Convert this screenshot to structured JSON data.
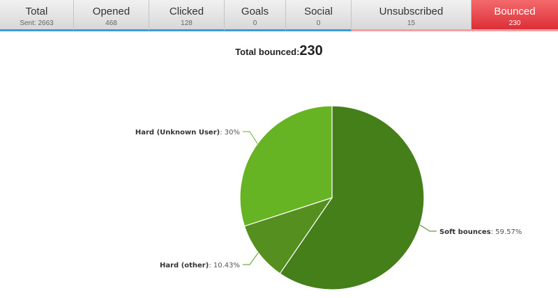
{
  "tabs": [
    {
      "label": "Total",
      "count": "Sent: 2663"
    },
    {
      "label": "Opened",
      "count": "468"
    },
    {
      "label": "Clicked",
      "count": "128"
    },
    {
      "label": "Goals",
      "count": "0"
    },
    {
      "label": "Social",
      "count": "0"
    },
    {
      "label": "Unsubscribed",
      "count": "15"
    },
    {
      "label": "Bounced",
      "count": "230"
    }
  ],
  "summary": {
    "label": "Total bounced:",
    "value": "230"
  },
  "colors": {
    "active_tab": "#e8424a",
    "tab_underline": "#3d9bd6"
  },
  "chart_data": {
    "type": "pie",
    "slices": [
      {
        "name": "Soft bounces",
        "value": 59.57,
        "label": "59.57%",
        "color": "#447f19"
      },
      {
        "name": "Hard (other)",
        "value": 10.43,
        "label": "10.43%",
        "color": "#558f20"
      },
      {
        "name": "Hard (Unknown User)",
        "value": 30,
        "label": "30%",
        "color": "#66b424"
      }
    ]
  }
}
